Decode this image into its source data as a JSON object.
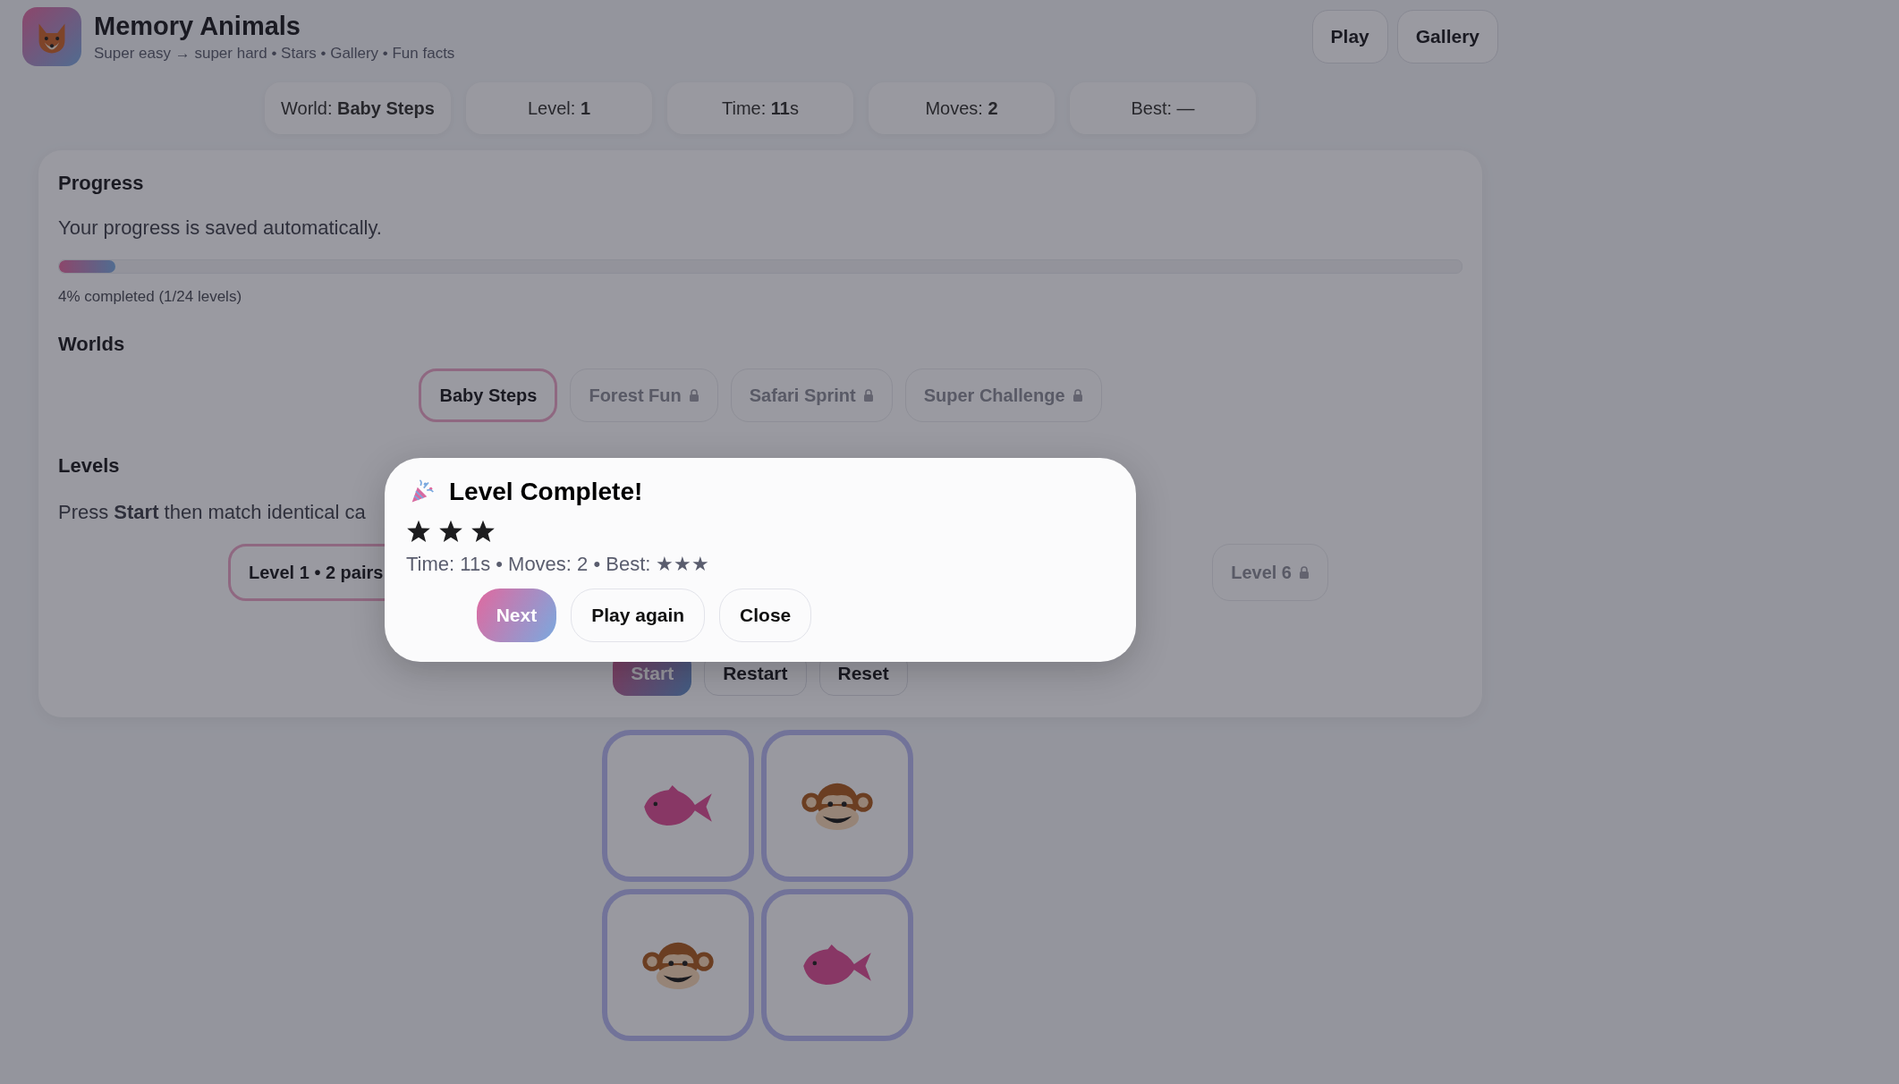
{
  "app": {
    "title": "Memory Animals",
    "subtitle": "Super easy → super hard • Stars • Gallery • Fun facts"
  },
  "nav": [
    {
      "label": "Play"
    },
    {
      "label": "Gallery"
    }
  ],
  "stats": [
    "World: **Baby Steps**",
    "Level: **1**",
    "Time: **11**s",
    "Moves: **2**",
    "Best: —"
  ],
  "progress": {
    "title": "Progress",
    "text": "Your progress is saved automatically.",
    "level": 0.04,
    "caption": "4% completed (1/24 levels)"
  },
  "worlds": {
    "title": "Worlds",
    "items": [
      {
        "label": "Baby Steps",
        "selected": true,
        "locked": false
      },
      {
        "label": "Forest Fun",
        "selected": false,
        "locked": true
      },
      {
        "label": "Safari Sprint",
        "selected": false,
        "locked": true
      },
      {
        "label": "Super Challenge",
        "selected": false,
        "locked": true
      }
    ]
  },
  "levels": {
    "title": "Levels",
    "hint": "Press **Start** then match identical ca",
    "items": [
      {
        "label": "Level 1 • 2 pairs",
        "selected": true,
        "locked": false
      },
      {
        "label": "Level 6",
        "selected": false,
        "locked": true
      }
    ]
  },
  "controls": [
    {
      "label": "Start",
      "disabled": true
    },
    {
      "label": "Restart",
      "disabled": false
    },
    {
      "label": "Reset",
      "disabled": false
    }
  ],
  "cards": [
    {
      "kind": "fish",
      "matched": true
    },
    {
      "kind": "monkey",
      "matched": true
    },
    {
      "kind": "monkey",
      "matched": true
    },
    {
      "kind": "fish",
      "matched": true
    }
  ],
  "dialog": {
    "title": "Level Complete!",
    "stars": 3,
    "summary": "Time: 11s • Moves: 2 • Best: ★★★",
    "buttons": [
      {
        "label": "Next",
        "kind": "primary"
      },
      {
        "label": "Play again",
        "kind": "secondary"
      },
      {
        "label": "Close",
        "kind": "secondary"
      }
    ]
  }
}
